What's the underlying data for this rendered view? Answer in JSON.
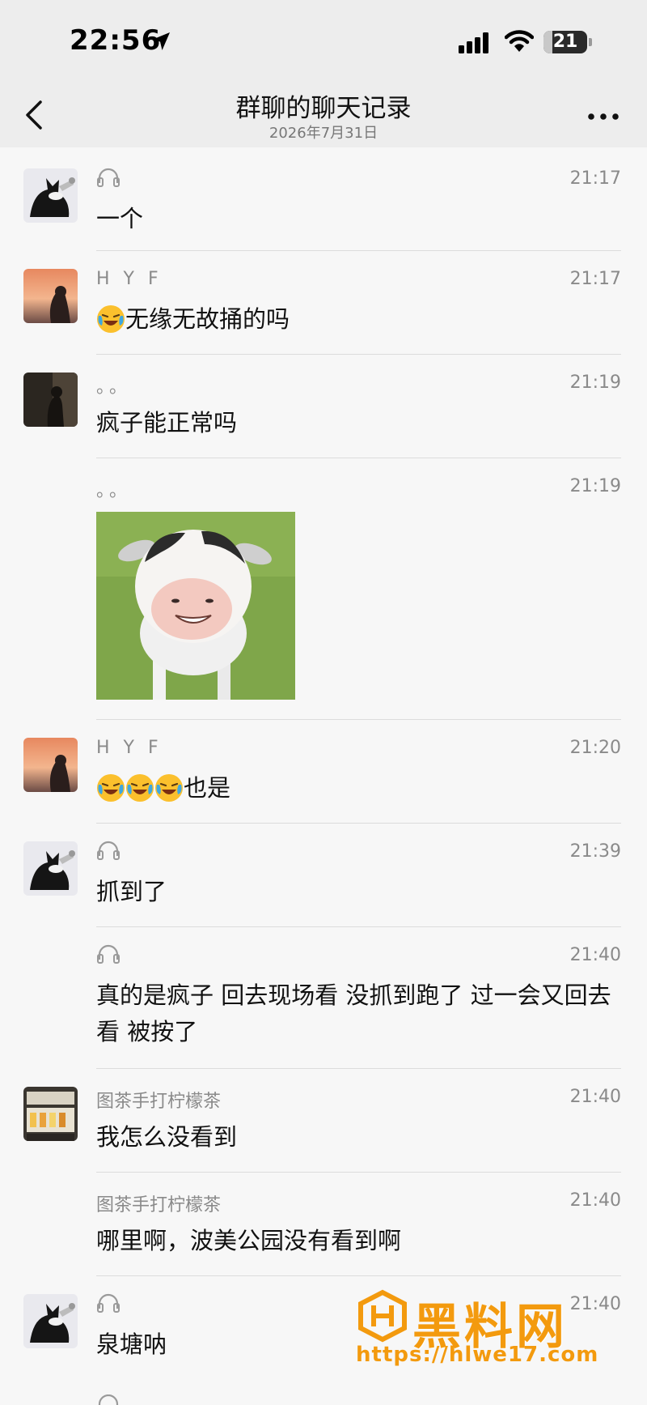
{
  "status_bar": {
    "time": "22:56",
    "battery": "21",
    "battery_level": 0.21
  },
  "header": {
    "title": "群聊的聊天记录",
    "date": "2026年7月31日"
  },
  "messages": [
    {
      "sender": "",
      "time": "21:17",
      "text": "一个"
    },
    {
      "sender": "H Y F",
      "time": "21:17",
      "text": "无缘无故捅的吗",
      "emojis": 1
    },
    {
      "sender": "。。",
      "time": "21:19",
      "text": "疯子能正常吗"
    },
    {
      "sender": "。。",
      "time": "21:19",
      "sticker": "cow-face-sticker"
    },
    {
      "sender": "H Y F",
      "time": "21:20",
      "text": "也是",
      "emojis": 3
    },
    {
      "sender": "",
      "time": "21:39",
      "text": "抓到了"
    },
    {
      "sender": "",
      "time": "21:40",
      "text": "真的是疯子 回去现场看 没抓到跑了 过一会又回去看 被按了"
    },
    {
      "sender": "图茶手打柠檬茶",
      "time": "21:40",
      "text": "我怎么没看到"
    },
    {
      "sender": "图茶手打柠檬茶",
      "time": "21:40",
      "text": "哪里啊，波美公园没有看到啊"
    },
    {
      "sender": "",
      "time": "21:40",
      "text": "泉塘呐"
    }
  ],
  "watermark": {
    "name": "黑料网",
    "url": "https://hlwe17.com"
  },
  "colors": {
    "background": "#f7f7f7",
    "header_bg": "#ededed",
    "meta_text": "#8a8a8a",
    "watermark": "#f39a0e"
  }
}
